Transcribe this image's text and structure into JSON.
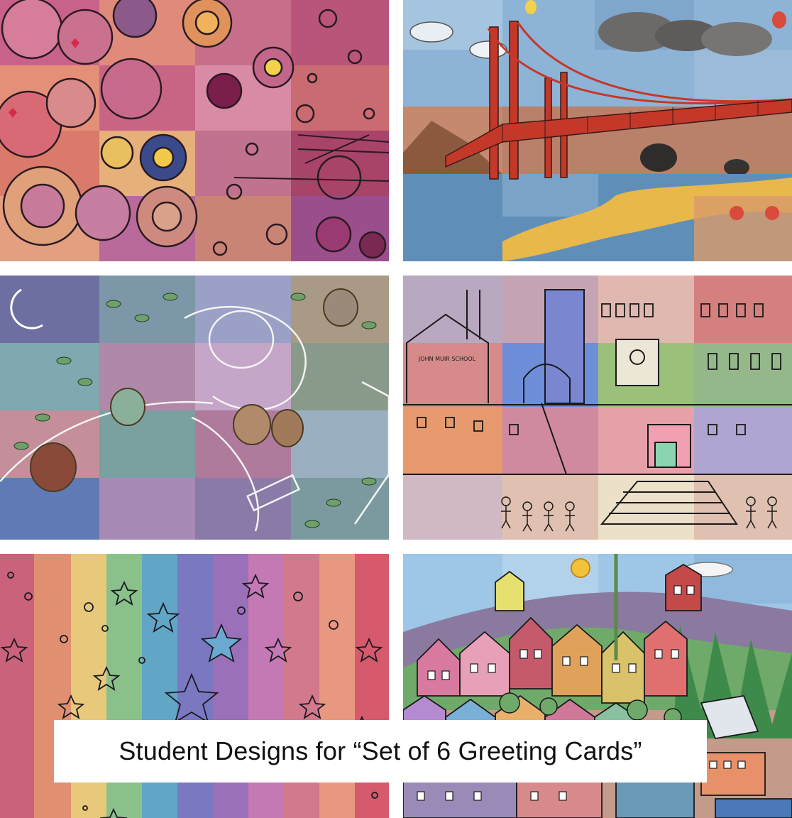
{
  "caption": "Student Designs for “Set of 6 Greeting Cards”",
  "cards": [
    {
      "subject": "circles-abstract",
      "palette": [
        "#d9707e",
        "#c95f86",
        "#e79a7c",
        "#9a5a8c",
        "#f0b07a"
      ]
    },
    {
      "subject": "golden-gate-bridge",
      "palette": [
        "#8fb6d8",
        "#c4432c",
        "#5a7fa8",
        "#e6c35a",
        "#6d6a63"
      ]
    },
    {
      "subject": "night-figures-leaves",
      "palette": [
        "#7e86b8",
        "#6f9f7a",
        "#b07aa6",
        "#5f8fb4",
        "#c9a26a"
      ]
    },
    {
      "subject": "john-muir-school",
      "palette": [
        "#e48870",
        "#6d8fd6",
        "#9ac07c",
        "#d66f8c",
        "#a894d6"
      ]
    },
    {
      "subject": "rainbow-stars",
      "palette": [
        "#d95a6e",
        "#f0a55a",
        "#e8d26a",
        "#7cc08a",
        "#5aa3cf",
        "#7a6ac4",
        "#b66ab8",
        "#d45a7a"
      ]
    },
    {
      "subject": "hillside-houses",
      "palette": [
        "#9ec6e6",
        "#c95c6f",
        "#6faa6a",
        "#e0a15a",
        "#8a7ab6"
      ]
    }
  ],
  "card4_school_sign": "JOHN MUIR SCHOOL"
}
